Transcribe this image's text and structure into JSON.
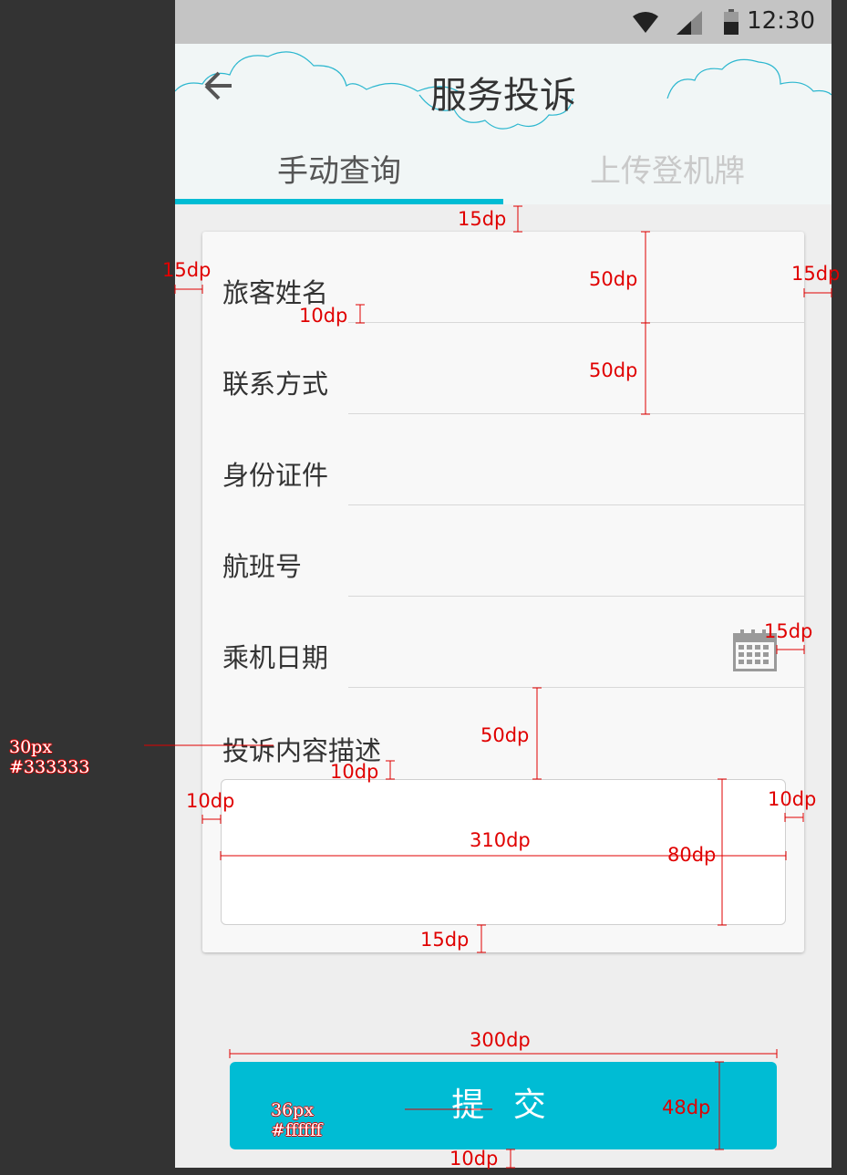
{
  "status_bar": {
    "time": "12:30"
  },
  "header": {
    "title": "服务投诉"
  },
  "tabs": [
    {
      "label": "手动查询",
      "active": true
    },
    {
      "label": "上传登机牌",
      "active": false
    }
  ],
  "form": {
    "fields": [
      {
        "label": "旅客姓名"
      },
      {
        "label": "联系方式"
      },
      {
        "label": "身份证件"
      },
      {
        "label": "航班号"
      },
      {
        "label": "乘机日期",
        "icon": "calendar-icon"
      }
    ],
    "description_label": "投诉内容描述"
  },
  "submit_label": "提 交",
  "colors": {
    "accent": "#00bcd4",
    "label_text": "#333333",
    "button_text": "#ffffff"
  },
  "annotations": {
    "top_gap": "15dp",
    "left_margin": "15dp",
    "right_margin": "15dp",
    "row1_height": "50dp",
    "row2_height": "50dp",
    "label_gap": "10dp",
    "calendar_margin": "15dp",
    "desc_height": "50dp",
    "desc_gap": "10dp",
    "textarea_left": "10dp",
    "textarea_right": "10dp",
    "textarea_width": "310dp",
    "textarea_height": "80dp",
    "card_bottom": "15dp",
    "button_width": "300dp",
    "button_height": "48dp",
    "button_bottom": "10dp",
    "label_font_size": "30px",
    "label_font_color": "#333333",
    "button_font_size": "36px",
    "button_font_color": "#ffffff"
  }
}
